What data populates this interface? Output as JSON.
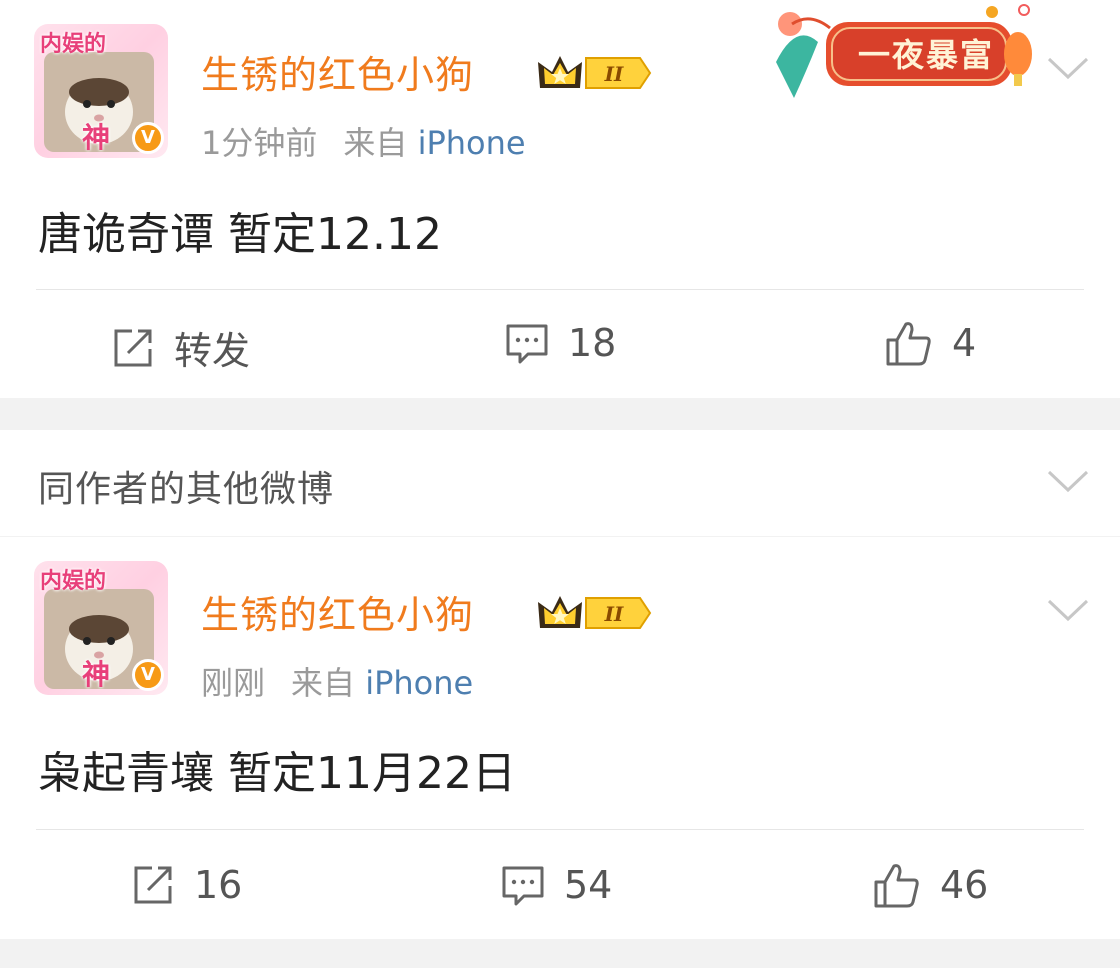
{
  "posts": [
    {
      "avatar_frame_text": "内娱的",
      "avatar_frame_text2": "神",
      "username": "生锈的红色小狗",
      "level": "II",
      "time": "1分钟前",
      "source_prefix": "来自",
      "source": "iPhone",
      "text": "唐诡奇谭 暂定12.12",
      "repost_label": "转发",
      "comments": "18",
      "likes": "4",
      "festival_badge": "一夜暴富"
    },
    {
      "avatar_frame_text": "内娱的",
      "avatar_frame_text2": "神",
      "username": "生锈的红色小狗",
      "level": "II",
      "time": "刚刚",
      "source_prefix": "来自",
      "source": "iPhone",
      "text": "枭起青壤 暂定11月22日",
      "reposts": "16",
      "comments": "54",
      "likes": "46"
    }
  ],
  "section": {
    "title": "同作者的其他微博"
  },
  "colors": {
    "username": "#f07b1d",
    "source": "#4e7fb0",
    "meta": "#9a9a9a",
    "background": "#f2f2f2"
  }
}
